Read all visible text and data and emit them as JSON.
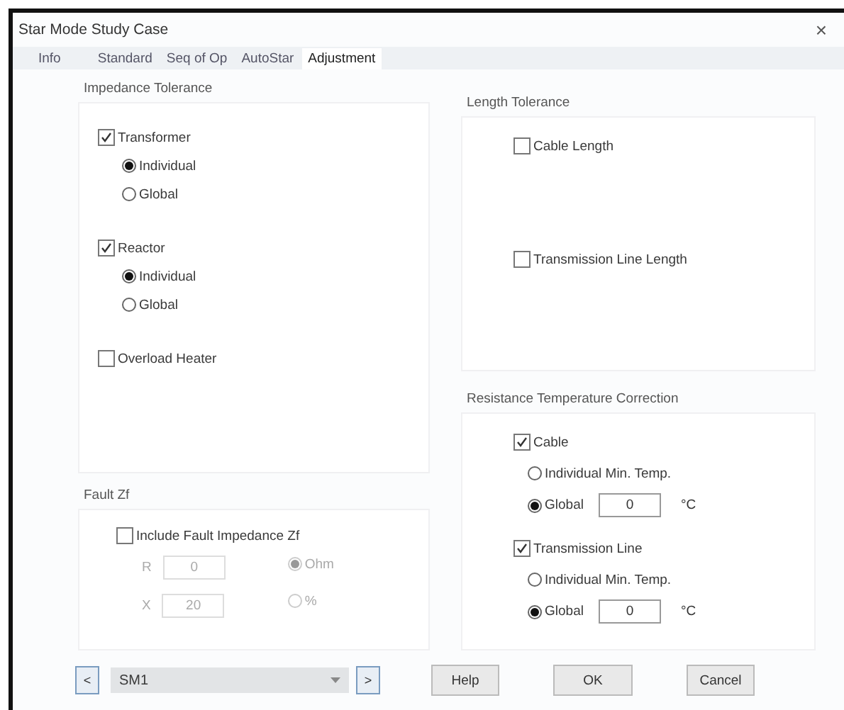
{
  "window": {
    "title": "Star Mode Study Case",
    "close": "×"
  },
  "tabs": [
    {
      "label": "Info",
      "selected": false
    },
    {
      "label": "Standard",
      "selected": false
    },
    {
      "label": "Seq of Op",
      "selected": false
    },
    {
      "label": "AutoStar",
      "selected": false
    },
    {
      "label": "Adjustment",
      "selected": true
    }
  ],
  "impedance_tolerance": {
    "title": "Impedance Tolerance",
    "items": [
      {
        "label": "Transformer",
        "checked": true,
        "options": [
          {
            "label": "Individual",
            "selected": true
          },
          {
            "label": "Global",
            "selected": false
          }
        ]
      },
      {
        "label": "Reactor",
        "checked": true,
        "options": [
          {
            "label": "Individual",
            "selected": true
          },
          {
            "label": "Global",
            "selected": false
          }
        ]
      },
      {
        "label": "Overload Heater",
        "checked": false
      }
    ]
  },
  "fault_zf": {
    "title": "Fault Zf",
    "include": {
      "label": "Include Fault Impedance Zf",
      "checked": false
    },
    "fields": [
      {
        "label": "R",
        "value": "0",
        "disabled": true
      },
      {
        "label": "X",
        "value": "20",
        "disabled": true
      }
    ],
    "units": [
      {
        "label": "Ohm",
        "selected": true,
        "disabled": true
      },
      {
        "label": "%",
        "selected": false,
        "disabled": true
      }
    ]
  },
  "length_tolerance": {
    "title": "Length Tolerance",
    "items": [
      {
        "label": "Cable Length",
        "checked": false
      },
      {
        "label": "Transmission Line Length",
        "checked": false
      }
    ]
  },
  "resistance_temperature_correction": {
    "title": "Resistance Temperature Correction",
    "items": [
      {
        "label": "Cable",
        "checked": true,
        "options": [
          {
            "label": "Individual Min. Temp.",
            "selected": false
          },
          {
            "label": "Global",
            "selected": true,
            "value": "0",
            "unit": "°C"
          }
        ]
      },
      {
        "label": "Transmission Line",
        "checked": true,
        "options": [
          {
            "label": "Individual Min. Temp.",
            "selected": false
          },
          {
            "label": "Global",
            "selected": true,
            "value": "0",
            "unit": "°C"
          }
        ]
      }
    ]
  },
  "footer": {
    "prev": "<",
    "config": "SM1",
    "next": ">",
    "buttons": [
      "Help",
      "OK",
      "Cancel"
    ]
  }
}
